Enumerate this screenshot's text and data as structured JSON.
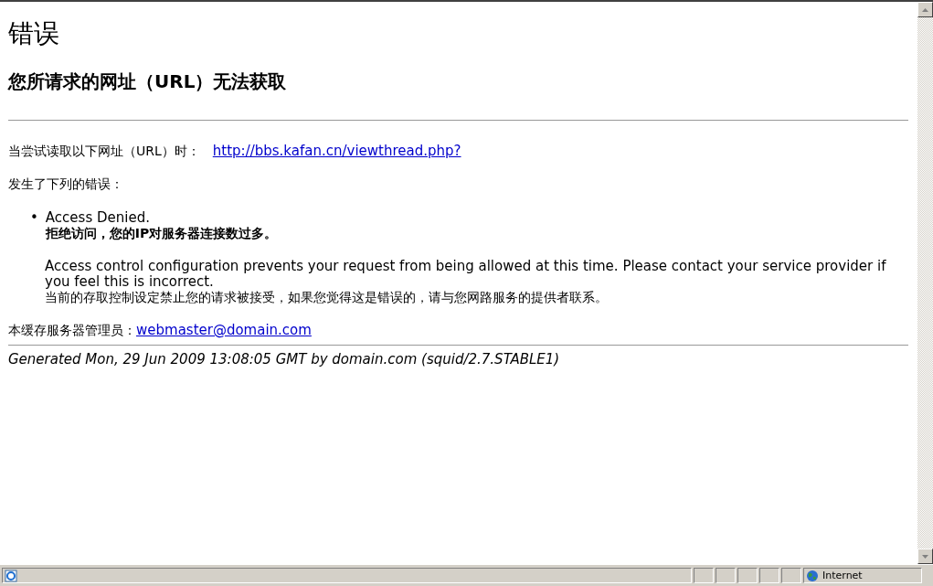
{
  "page": {
    "title": "错误",
    "subtitle": "您所请求的网址（URL）无法获取",
    "attempt_label": "当尝试读取以下网址（URL）时：",
    "attempt_url": "http://bbs.kafan.cn/viewthread.php?",
    "error_intro": "发生了下列的错误：",
    "errors": [
      {
        "marker": "•",
        "heading": "Access Denied.",
        "heading_cn": "拒绝访问，您的IP对服务器连接数过多。"
      }
    ],
    "explanation": "Access control configuration prevents your request from being allowed at this time. Please contact your service provider if you feel this is incorrect.",
    "explanation_cn": "当前的存取控制设定禁止您的请求被接受，如果您觉得这是错误的，请与您网路服务的提供者联系。",
    "admin_label": "本缓存服务器管理员：",
    "admin_email": "webmaster@domain.com",
    "footer": "Generated Mon, 29 Jun 2009 13:08:05 GMT by domain.com (squid/2.7.STABLE1)"
  },
  "status_bar": {
    "zone": "Internet"
  }
}
